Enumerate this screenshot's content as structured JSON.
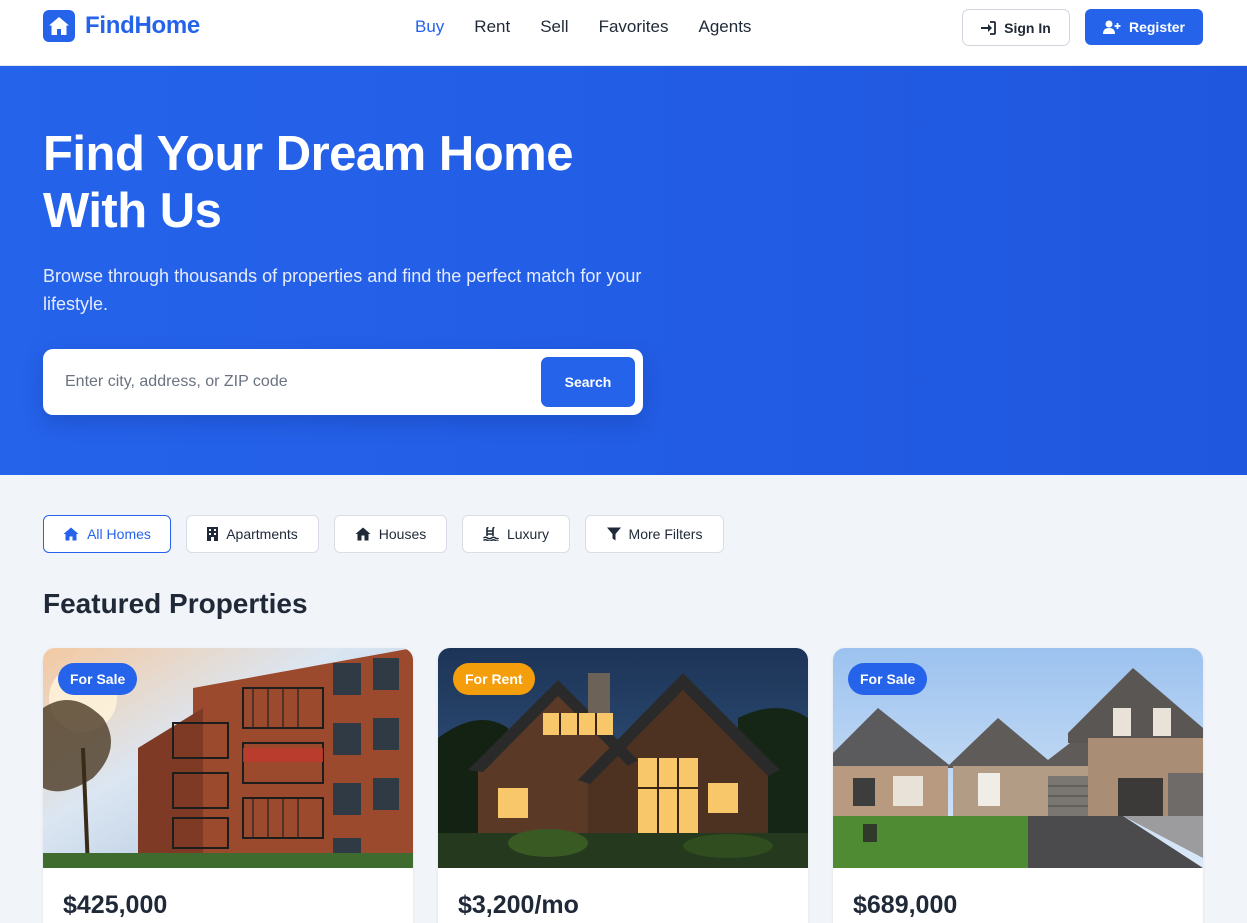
{
  "brand": {
    "name": "FindHome"
  },
  "nav": {
    "items": [
      "Buy",
      "Rent",
      "Sell",
      "Favorites",
      "Agents"
    ],
    "active": "Buy"
  },
  "auth": {
    "signin_label": "Sign In",
    "register_label": "Register"
  },
  "hero": {
    "title_line1": "Find Your Dream Home",
    "title_line2": "With Us",
    "subtitle": "Browse through thousands of properties and find the perfect match for your lifestyle.",
    "search_placeholder": "Enter city, address, or ZIP code",
    "search_button": "Search"
  },
  "filters": [
    {
      "label": "All Homes",
      "icon": "home-icon",
      "active": true
    },
    {
      "label": "Apartments",
      "icon": "building-icon",
      "active": false
    },
    {
      "label": "Houses",
      "icon": "house-icon",
      "active": false
    },
    {
      "label": "Luxury",
      "icon": "pool-icon",
      "active": false
    },
    {
      "label": "More Filters",
      "icon": "filter-icon",
      "active": false
    }
  ],
  "featured": {
    "title": "Featured Properties",
    "cards": [
      {
        "badge": "For Sale",
        "badge_color": "#2563eb",
        "price": "$425,000"
      },
      {
        "badge": "For Rent",
        "badge_color": "#f59e0b",
        "price": "$3,200/mo"
      },
      {
        "badge": "For Sale",
        "badge_color": "#2563eb",
        "price": "$689,000"
      }
    ]
  },
  "colors": {
    "primary": "#2563eb",
    "rent_badge": "#f59e0b",
    "page_bg": "#f1f4f9"
  }
}
